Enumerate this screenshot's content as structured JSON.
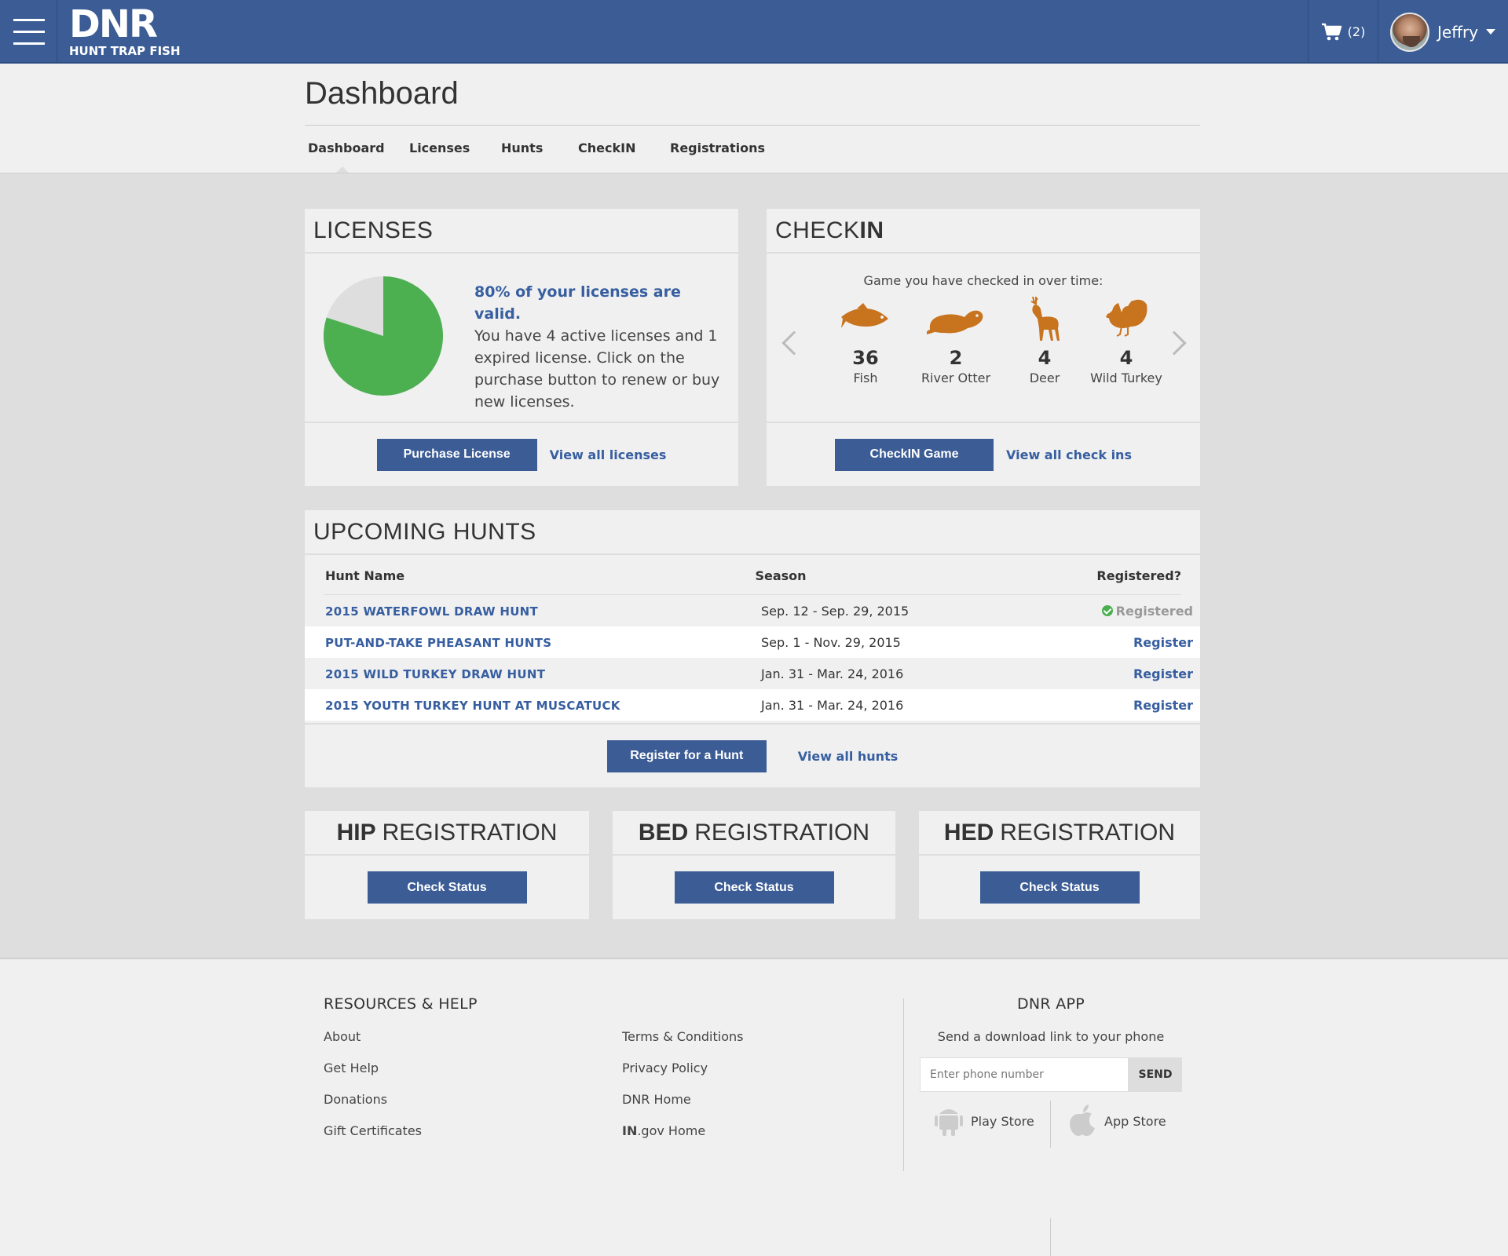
{
  "header": {
    "logo_main": "DNR",
    "logo_sub": "HUNT TRAP FISH",
    "cart_count": "(2)",
    "user_name": "Jeffry"
  },
  "page": {
    "title": "Dashboard",
    "tabs": [
      {
        "label": "Dashboard",
        "active": true
      },
      {
        "label": "Licenses"
      },
      {
        "label": "Hunts"
      },
      {
        "label": "CheckIN"
      },
      {
        "label": "Registrations"
      }
    ]
  },
  "licenses": {
    "title": "LICENSES",
    "valid_percent": 80,
    "highlight": "80% of your licenses are valid.",
    "body": "You have 4 active licenses and 1 expired license. Click on the purchase button to renew or buy new licenses.",
    "purchase_label": "Purchase License",
    "view_all_label": "View all licenses",
    "colors": {
      "valid": "#4caf50",
      "expired": "#dedede"
    }
  },
  "checkin": {
    "title_light": "CHECK",
    "title_bold": "IN",
    "subtitle": "Game you have checked in over time:",
    "items": [
      {
        "count": "36",
        "label": "Fish",
        "icon": "fish-icon"
      },
      {
        "count": "2",
        "label": "River Otter",
        "icon": "otter-icon"
      },
      {
        "count": "4",
        "label": "Deer",
        "icon": "deer-icon"
      },
      {
        "count": "4",
        "label": "Wild Turkey",
        "icon": "turkey-icon"
      }
    ],
    "icon_color": "#c8731e",
    "checkin_label": "CheckIN Game",
    "view_all_label": "View all check ins"
  },
  "hunts": {
    "title": "UPCOMING HUNTS",
    "columns": {
      "name": "Hunt Name",
      "season": "Season",
      "registered": "Registered?"
    },
    "rows": [
      {
        "name": "2015 WATERFOWL DRAW HUNT",
        "season": "Sep. 12 - Sep. 29, 2015",
        "status": "Registered"
      },
      {
        "name": "PUT-AND-TAKE PHEASANT HUNTS",
        "season": "Sep. 1 - Nov. 29, 2015",
        "status": "Register"
      },
      {
        "name": "2015 WILD TURKEY DRAW HUNT",
        "season": "Jan. 31 - Mar. 24, 2016",
        "status": "Register"
      },
      {
        "name": "2015 YOUTH TURKEY HUNT AT MUSCATUCK",
        "season": "Jan. 31 - Mar. 24, 2016",
        "status": "Register"
      }
    ],
    "register_label": "Register for a Hunt",
    "view_all_label": "View all hunts"
  },
  "registrations": [
    {
      "bold": "HIP",
      "light": "REGISTRATION",
      "button": "Check Status"
    },
    {
      "bold": "BED",
      "light": "REGISTRATION",
      "button": "Check Status"
    },
    {
      "bold": "HED",
      "light": "REGISTRATION",
      "button": "Check Status"
    }
  ],
  "footer": {
    "resources_title": "RESOURCES & HELP",
    "links_col1": [
      "About",
      "Get Help",
      "Donations",
      "Gift Certificates"
    ],
    "links_col2": [
      "Terms & Conditions",
      "Privacy Policy",
      "DNR Home"
    ],
    "ingov_bold": "IN",
    "ingov_rest": ".gov Home",
    "app_title": "DNR APP",
    "app_subtitle": "Send a download link to your phone",
    "phone_placeholder": "Enter phone number",
    "send_label": "SEND",
    "play_store": "Play Store",
    "app_store": "App Store"
  }
}
